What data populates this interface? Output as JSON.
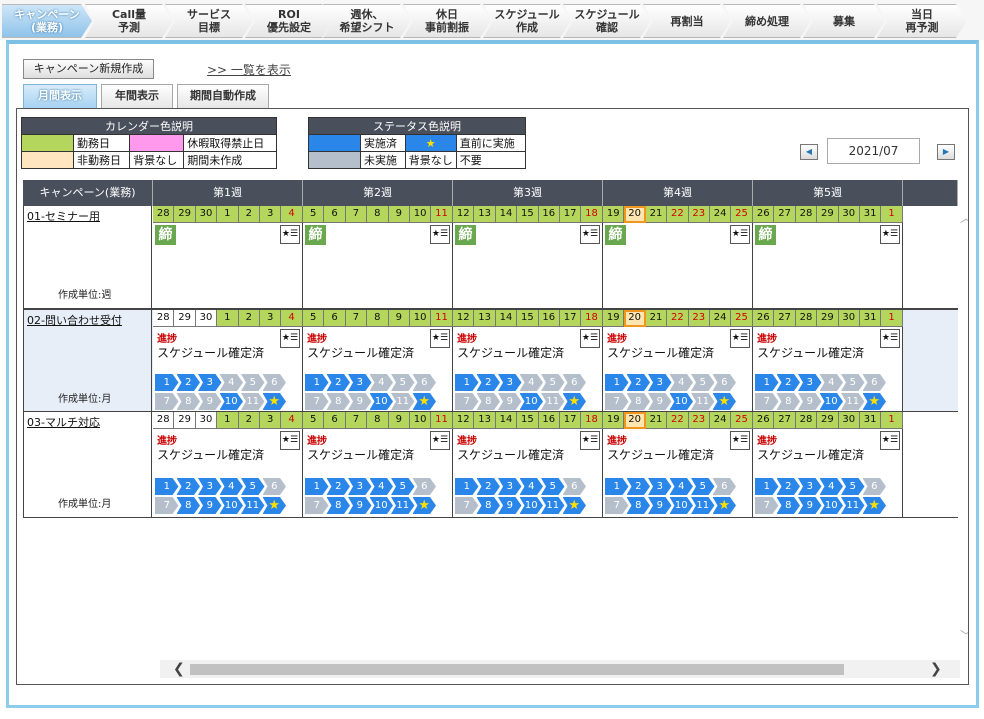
{
  "process_tabs": [
    {
      "label": "キャンペーン\n(業務)",
      "active": true
    },
    {
      "label": "Call量\n予測"
    },
    {
      "label": "サービス\n目標"
    },
    {
      "label": "ROI\n優先設定"
    },
    {
      "label": "週休、\n希望シフト"
    },
    {
      "label": "休日\n事前割振"
    },
    {
      "label": "スケジュール\n作成"
    },
    {
      "label": "スケジュール\n確認"
    },
    {
      "label": "再割当"
    },
    {
      "label": "締め処理"
    },
    {
      "label": "募集"
    },
    {
      "label": "当日\n再予測"
    }
  ],
  "toolbar": {
    "new_campaign": "キャンペーン新規作成",
    "list_link": ">> 一覧を表示"
  },
  "view_tabs": [
    {
      "label": "月間表示",
      "active": true
    },
    {
      "label": "年間表示"
    },
    {
      "label": "期間自動作成"
    }
  ],
  "calendar_legend": {
    "title": "カレンダー色説明",
    "work": "勤務日",
    "leave_banned": "休暇取得禁止日",
    "nonwork": "非勤務日",
    "no_bg": "背景なし",
    "period_not_created": "期間未作成",
    "colors": {
      "work": "#b5d65c",
      "leave_banned": "#ff99ee",
      "nonwork": "#ffe5c0"
    }
  },
  "status_legend": {
    "title": "ステータス色説明",
    "done": "実施済",
    "star": "★",
    "just_before": "直前に実施",
    "not_done": "未実施",
    "no_bg": "背景なし",
    "unneeded": "不要",
    "colors": {
      "done": "#2a86e8",
      "not_done": "#b5bfcc"
    }
  },
  "month_nav": {
    "current": "2021/07",
    "prev_icon": "triangle-left-icon",
    "next_icon": "triangle-right-icon"
  },
  "grid": {
    "name_header": "キャンペーン(業務)",
    "week_headers": [
      "第1週",
      "第2週",
      "第3週",
      "第4週",
      "第5週"
    ],
    "weeks": [
      [
        {
          "d": "28",
          "t": "work"
        },
        {
          "d": "29",
          "t": "work"
        },
        {
          "d": "30",
          "t": "work"
        },
        {
          "d": "1",
          "t": "work"
        },
        {
          "d": "2",
          "t": "work"
        },
        {
          "d": "3",
          "t": "work"
        },
        {
          "d": "4",
          "t": "work",
          "red": true
        }
      ],
      [
        {
          "d": "5",
          "t": "work"
        },
        {
          "d": "6",
          "t": "work"
        },
        {
          "d": "7",
          "t": "work"
        },
        {
          "d": "8",
          "t": "work"
        },
        {
          "d": "9",
          "t": "work"
        },
        {
          "d": "10",
          "t": "work"
        },
        {
          "d": "11",
          "t": "work",
          "red": true
        }
      ],
      [
        {
          "d": "12",
          "t": "work"
        },
        {
          "d": "13",
          "t": "work"
        },
        {
          "d": "14",
          "t": "work"
        },
        {
          "d": "15",
          "t": "work"
        },
        {
          "d": "16",
          "t": "work"
        },
        {
          "d": "17",
          "t": "work"
        },
        {
          "d": "18",
          "t": "work",
          "red": true
        }
      ],
      [
        {
          "d": "19",
          "t": "work"
        },
        {
          "d": "20",
          "t": "hl"
        },
        {
          "d": "21",
          "t": "work"
        },
        {
          "d": "22",
          "t": "work",
          "red": true
        },
        {
          "d": "23",
          "t": "work",
          "red": true
        },
        {
          "d": "24",
          "t": "work"
        },
        {
          "d": "25",
          "t": "work",
          "red": true
        }
      ],
      [
        {
          "d": "26",
          "t": "work"
        },
        {
          "d": "27",
          "t": "work"
        },
        {
          "d": "28",
          "t": "work"
        },
        {
          "d": "29",
          "t": "work"
        },
        {
          "d": "30",
          "t": "work"
        },
        {
          "d": "31",
          "t": "work"
        },
        {
          "d": "1",
          "t": "work",
          "red": true
        }
      ]
    ],
    "rows": [
      {
        "name": "01-セミナー用",
        "unit": "作成単位:週",
        "kind": "shime",
        "shime_label": "締",
        "firstweek_off": 0
      },
      {
        "name": "02-問い合わせ受付",
        "unit": "作成単位:月",
        "kind": "progress",
        "progress_label": "進捗",
        "status": "スケジュール確定済",
        "firstweek_off": 3,
        "steps": [
          [
            "b",
            "b",
            "b",
            "g",
            "g",
            "g"
          ],
          [
            "g",
            "g",
            "g",
            "b",
            "g",
            "b"
          ]
        ]
      },
      {
        "name": "03-マルチ対応",
        "unit": "作成単位:月",
        "kind": "progress",
        "progress_label": "進捗",
        "status": "スケジュール確定済",
        "firstweek_off": 3,
        "steps": [
          [
            "b",
            "b",
            "b",
            "b",
            "b",
            "g"
          ],
          [
            "g",
            "b",
            "b",
            "b",
            "b",
            "b"
          ]
        ]
      }
    ],
    "step_labels": [
      [
        "1",
        "2",
        "3",
        "4",
        "5",
        "6"
      ],
      [
        "7",
        "8",
        "9",
        "10",
        "11",
        "★"
      ]
    ],
    "star_icon_text": "★☰"
  }
}
